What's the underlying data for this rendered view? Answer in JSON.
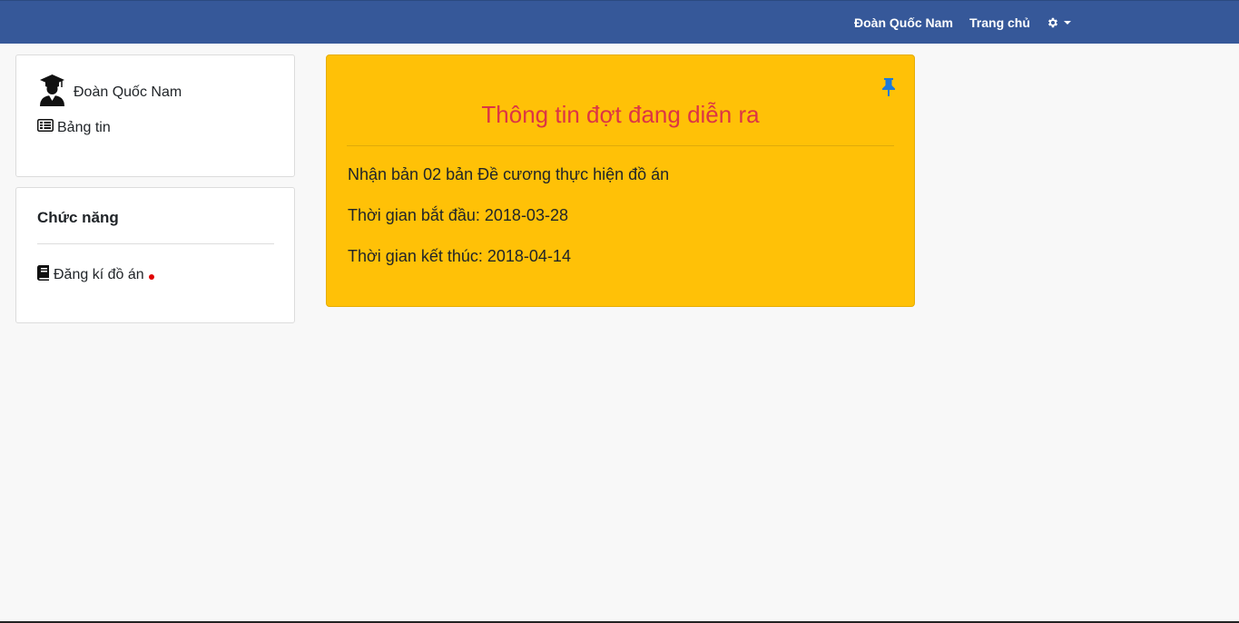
{
  "navbar": {
    "user_name": "Đoàn Quốc Nam",
    "home_label": "Trang chủ",
    "settings_icon": "gear-icon",
    "background_color": "#365899"
  },
  "sidebar": {
    "profile": {
      "avatar_icon": "graduate-user-icon",
      "name": "Đoàn Quốc Nam",
      "news_icon": "list-icon",
      "news_label": "Bảng tin"
    },
    "functions": {
      "title": "Chức năng",
      "items": [
        {
          "icon": "book-icon",
          "label": "Đăng kí đồ án",
          "has_notification_dot": true,
          "dot_color": "#e00000"
        }
      ]
    }
  },
  "main": {
    "panel": {
      "background_color": "#ffc107",
      "title": "Thông tin đợt đang diễn ra",
      "title_color": "#dc3545",
      "pin_icon": "pin-icon",
      "pin_color": "#1e7ad9",
      "description": "Nhận bản 02 bản Đề cương thực hiện đồ án",
      "start_label": "Thời gian bắt đầu: 2018-03-28",
      "end_label": "Thời gian kết thúc: 2018-04-14"
    }
  }
}
